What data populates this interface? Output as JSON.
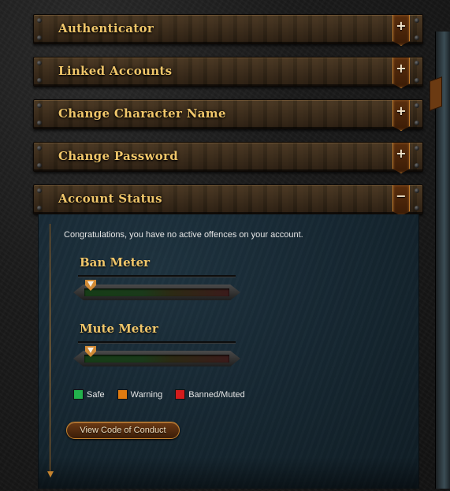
{
  "panels": [
    {
      "title": "Authenticator",
      "toggle": "+"
    },
    {
      "title": "Linked Accounts",
      "toggle": "+"
    },
    {
      "title": "Change Character Name",
      "toggle": "+"
    },
    {
      "title": "Change Password",
      "toggle": "+"
    },
    {
      "title": "Account Status",
      "toggle": "−"
    }
  ],
  "account_status": {
    "message": "Congratulations, you have no active offences on your account.",
    "ban_meter": {
      "title": "Ban Meter",
      "level": 0
    },
    "mute_meter": {
      "title": "Mute Meter",
      "level": 0
    },
    "legend": [
      {
        "label": "Safe",
        "color": "#22b14c"
      },
      {
        "label": "Warning",
        "color": "#e07b10"
      },
      {
        "label": "Banned/Muted",
        "color": "#d31c1c"
      }
    ],
    "code_of_conduct_button": "View Code of Conduct"
  }
}
